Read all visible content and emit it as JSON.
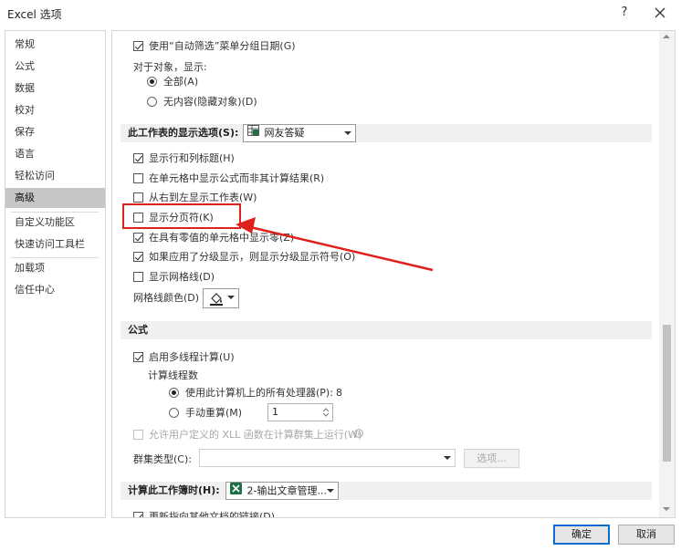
{
  "window": {
    "title": "Excel 选项",
    "help_glyph": "?",
    "close_glyph": "✕"
  },
  "sidebar": {
    "items": [
      {
        "label": "常规"
      },
      {
        "label": "公式"
      },
      {
        "label": "数据"
      },
      {
        "label": "校对"
      },
      {
        "label": "保存"
      },
      {
        "label": "语言"
      },
      {
        "label": "轻松访问"
      },
      {
        "label": "高级",
        "active": true
      },
      {
        "label": "自定义功能区"
      },
      {
        "label": "快速访问工具栏"
      },
      {
        "label": "加载项"
      },
      {
        "label": "信任中心"
      }
    ]
  },
  "content": {
    "autofilter_group_dates": "使用“自动筛选”菜单分组日期(G)",
    "objects_label": "对于对象，显示:",
    "objects_all": "全部(A)",
    "objects_none": "无内容(隐藏对象)(D)",
    "ws_section": {
      "label": "此工作表的显示选项(S):",
      "sheet_name": "网友答疑"
    },
    "ws_options": [
      {
        "label": "显示行和列标题(H)",
        "checked": true
      },
      {
        "label": "在单元格中显示公式而非其计算结果(R)",
        "checked": false
      },
      {
        "label": "从右到左显示工作表(W)",
        "checked": false
      },
      {
        "label": "显示分页符(K)",
        "checked": false
      },
      {
        "label": "在具有零值的单元格中显示零(Z)",
        "checked": true
      },
      {
        "label": "如果应用了分级显示，则显示分级显示符号(O)",
        "checked": true
      },
      {
        "label": "显示网格线(D)",
        "checked": false
      }
    ],
    "gridline_color_label": "网格线颜色(D)",
    "formulas_section": "公式",
    "multithread": "启用多线程计算(U)",
    "threads_label": "计算线程数",
    "use_all_processors": "使用此计算机上的所有处理器(P):",
    "processor_count": "8",
    "manual": "手动重算(M)",
    "manual_value": "1",
    "xll": "允许用户定义的 XLL 函数在计算群集上运行(W)",
    "cluster_type_label": "群集类型(C):",
    "options_button": "选项...",
    "wb_section": {
      "label": "计算此工作簿时(H):",
      "workbook_name": "2-输出文章管理..."
    },
    "update_links": "更新指向其他文档的链接(D)"
  },
  "footer": {
    "ok": "确定",
    "cancel": "取消"
  },
  "colors": {
    "accent": "#0a6fd0",
    "highlight": "#e0201c",
    "excel_green": "#1e7145",
    "sidebar_active": "#c6c6c6"
  }
}
